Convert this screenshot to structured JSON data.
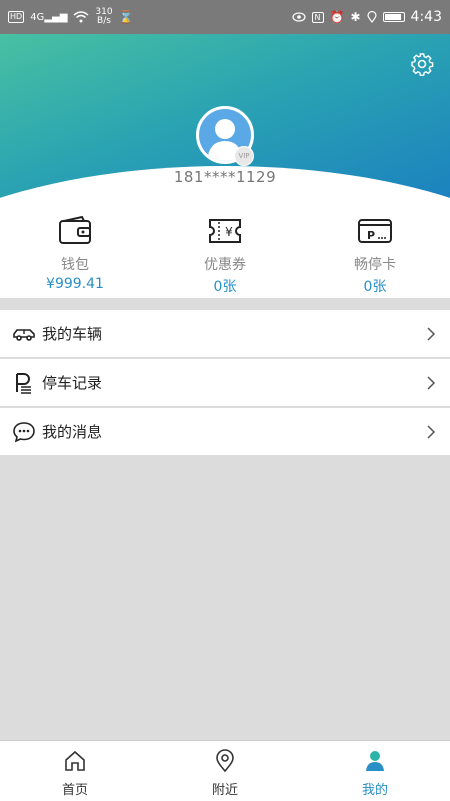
{
  "status_bar": {
    "network": "4G",
    "speed_value": "310",
    "speed_unit": "B/s",
    "time": "4:43",
    "battery_level": 0.9,
    "icons": [
      "hd-icon",
      "signal-icon",
      "wifi-icon",
      "hourglass-icon",
      "eye-icon",
      "nfc-icon",
      "alarm-icon",
      "bluetooth-icon",
      "location-icon",
      "battery-icon"
    ]
  },
  "colors": {
    "header_start": "#48c0a2",
    "header_end": "#1a7fc0",
    "accent": "#2a8fc7"
  },
  "profile": {
    "phone": "181****1129",
    "vip_label": "VIP"
  },
  "stats": [
    {
      "label": "钱包",
      "value": "¥999.41",
      "icon": "wallet-icon"
    },
    {
      "label": "优惠券",
      "value": "0张",
      "icon": "coupon-icon"
    },
    {
      "label": "畅停卡",
      "value": "0张",
      "icon": "parking-card-icon"
    }
  ],
  "menu": [
    {
      "label": "我的车辆",
      "icon": "car-icon"
    },
    {
      "label": "停车记录",
      "icon": "parking-record-icon"
    },
    {
      "label": "我的消息",
      "icon": "message-icon"
    }
  ],
  "bottom_nav": [
    {
      "label": "首页",
      "icon": "home-icon",
      "active": false
    },
    {
      "label": "附近",
      "icon": "location-pin-icon",
      "active": false
    },
    {
      "label": "我的",
      "icon": "profile-icon",
      "active": true
    }
  ]
}
